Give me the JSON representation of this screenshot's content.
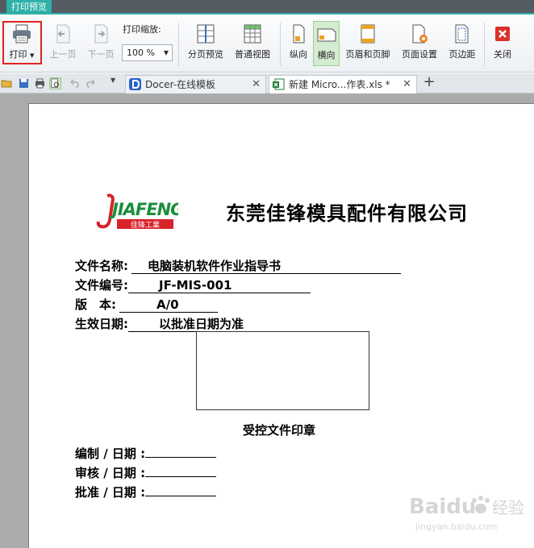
{
  "window": {
    "tab_label": "打印预览"
  },
  "ribbon": {
    "print_label": "打印",
    "prev_page_label": "上一页",
    "next_page_label": "下一页",
    "zoom_label": "打印缩放:",
    "zoom_value": "100 %",
    "page_break_preview_label": "分页预览",
    "normal_view_label": "普通视图",
    "portrait_label": "纵向",
    "landscape_label": "横向",
    "header_footer_label": "页眉和页脚",
    "page_setup_label": "页面设置",
    "margins_label": "页边距",
    "close_label": "关闭"
  },
  "doc_tabs": [
    {
      "label": "Docer-在线模板",
      "close": "✕"
    },
    {
      "label": "新建 Micro...作表.xls *",
      "close": "✕"
    }
  ],
  "new_tab": "+",
  "document": {
    "logo_text": "JIAFENG",
    "logo_subtext": "佳锋工業",
    "company_name": "东莞佳锋模具配件有限公司",
    "fields": [
      {
        "label": "文件名称:",
        "value": "电脑装机软件作业指导书"
      },
      {
        "label": "文件编号:",
        "value": "JF-MIS-001"
      },
      {
        "label": "版　本:",
        "value": "A/0"
      },
      {
        "label": "生效日期:",
        "value": "以批准日期为准"
      }
    ],
    "stamp_caption": "受控文件印章",
    "signoffs": [
      {
        "label": "编制 / 日期 :"
      },
      {
        "label": "审核 / 日期 :"
      },
      {
        "label": "批准 / 日期 :"
      }
    ]
  },
  "watermark": {
    "brand": "Baidu",
    "cn": "经验",
    "url": "jingyan.baidu.com"
  },
  "colors": {
    "accent": "#2fb0a8",
    "highlight": "#e0221e",
    "logo_red": "#d8232a",
    "logo_green": "#1a8f3c"
  }
}
